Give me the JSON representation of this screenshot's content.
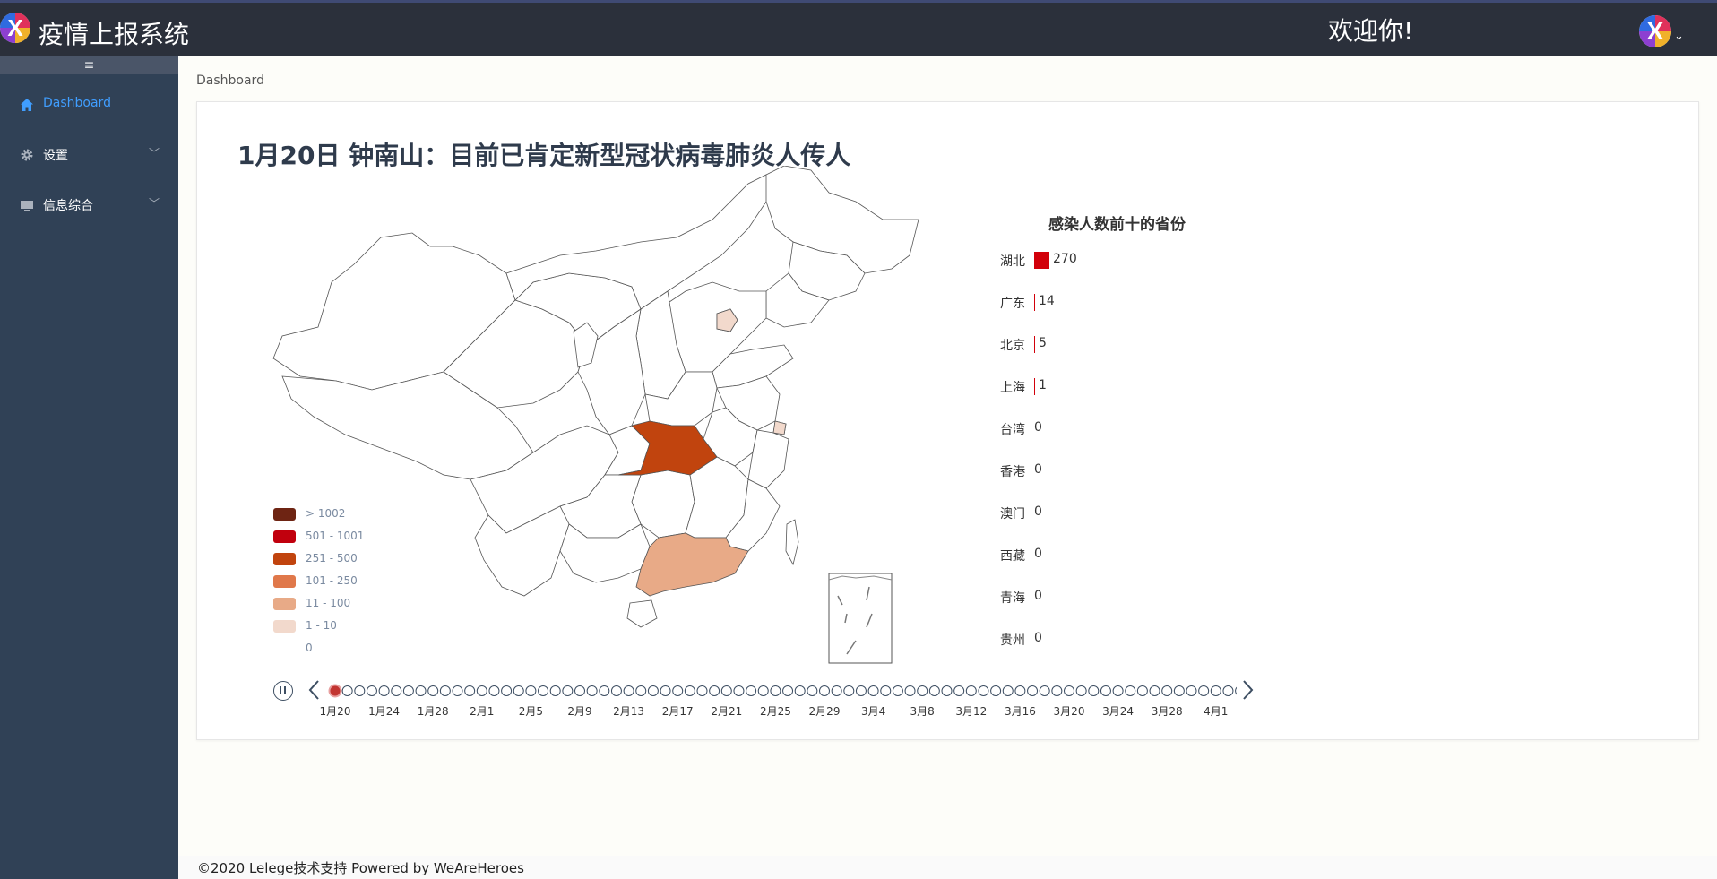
{
  "app": {
    "title": "疫情上报系统",
    "welcome": "欢迎你!"
  },
  "sidebar": {
    "toggle": "≡",
    "items": [
      {
        "label": "Dashboard",
        "icon": "home-icon",
        "active": true
      },
      {
        "label": "设置",
        "icon": "gear-icon",
        "active": false
      },
      {
        "label": "信息综合",
        "icon": "monitor-icon",
        "active": false
      }
    ]
  },
  "breadcrumb": "Dashboard",
  "news_title": "1月20日  钟南山：目前已肯定新型冠状病毒肺炎人传人",
  "legend": [
    {
      "label": "> 1002",
      "color": "#6e2413"
    },
    {
      "label": "501 - 1001",
      "color": "#c1000d"
    },
    {
      "label": "251 - 500",
      "color": "#c1440e"
    },
    {
      "label": "101 - 250",
      "color": "#e0784a"
    },
    {
      "label": "11 - 100",
      "color": "#e8aa87"
    },
    {
      "label": "1 - 10",
      "color": "#f2d9cc"
    },
    {
      "label": "0",
      "color": "#ffffff"
    }
  ],
  "chart_data": {
    "type": "bar",
    "title": "感染人数前十的省份",
    "categories": [
      "湖北",
      "广东",
      "北京",
      "上海",
      "台湾",
      "香港",
      "澳门",
      "西藏",
      "青海",
      "贵州"
    ],
    "values": [
      270,
      14,
      5,
      1,
      0,
      0,
      0,
      0,
      0,
      0
    ],
    "bar_color": "#d2000a"
  },
  "timeline": {
    "tick_labels": [
      "1月20",
      "1月24",
      "1月28",
      "2月1",
      "2月5",
      "2月9",
      "2月13",
      "2月17",
      "2月21",
      "2月25",
      "2月29",
      "3月4",
      "3月8",
      "3月12",
      "3月16",
      "3月20",
      "3月24",
      "3月28",
      "4月1"
    ],
    "dot_count": 75,
    "current": "1月20"
  },
  "footer": "©2020 Lelege技术支持 Powered by WeAreHeroes"
}
